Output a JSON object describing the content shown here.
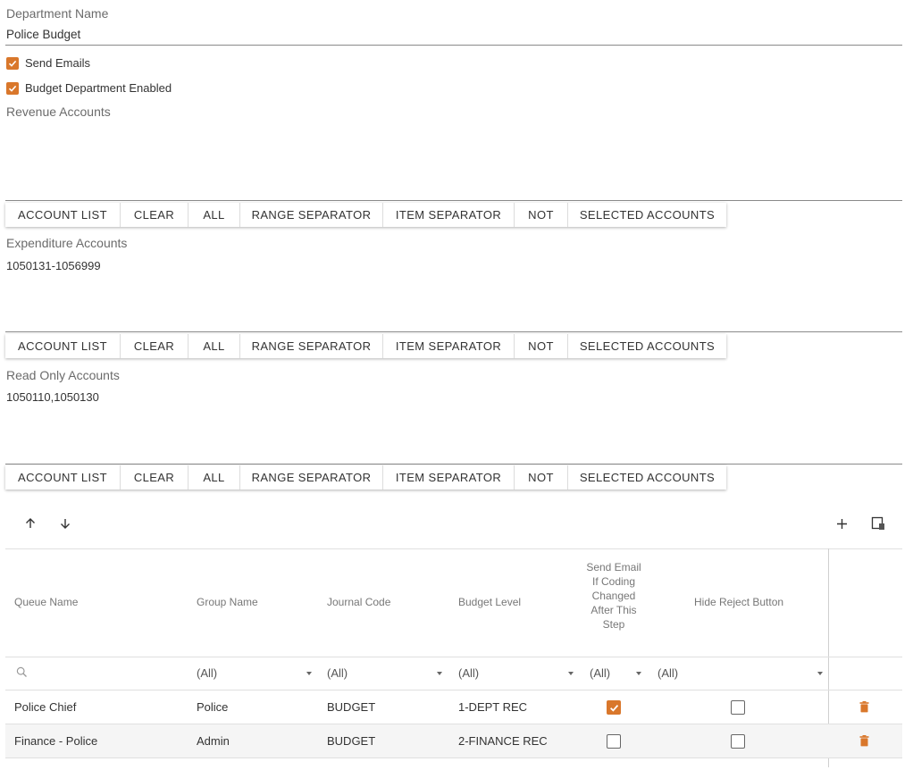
{
  "department": {
    "label": "Department Name",
    "value": "Police Budget"
  },
  "checkboxes": [
    {
      "label": "Send Emails",
      "checked": true
    },
    {
      "label": "Budget Department Enabled",
      "checked": true
    }
  ],
  "accent_color": "#d9772b",
  "sections": [
    {
      "label": "Revenue Accounts",
      "value": ""
    },
    {
      "label": "Expenditure Accounts",
      "value": "1050131-1056999"
    },
    {
      "label": "Read Only Accounts",
      "value": "1050110,1050130"
    }
  ],
  "toolbar_buttons": [
    "ACCOUNT LIST",
    "CLEAR",
    "ALL",
    "RANGE SEPARATOR",
    "ITEM SEPARATOR",
    "NOT",
    "SELECTED ACCOUNTS"
  ],
  "grid": {
    "toolbar_icons": [
      "arrow-up-icon",
      "arrow-down-icon",
      "plus-icon",
      "column-chooser-icon"
    ],
    "columns": [
      "Queue Name",
      "Group Name",
      "Journal Code",
      "Budget Level",
      "Send Email If Coding Changed After This Step",
      "Hide Reject Button"
    ],
    "filters": {
      "search_icon": "search-icon",
      "group": "(All)",
      "journal": "(All)",
      "level": "(All)",
      "email": "(All)",
      "reject": "(All)"
    },
    "rows": [
      {
        "queue": "Police Chief",
        "group": "Police",
        "journal": "BUDGET",
        "level": "1-DEPT REC",
        "send_email": true,
        "hide_reject": false,
        "action_icon": "trash-icon"
      },
      {
        "queue": "Finance - Police",
        "group": "Admin",
        "journal": "BUDGET",
        "level": "2-FINANCE REC",
        "send_email": false,
        "hide_reject": false,
        "action_icon": "trash-icon"
      }
    ]
  }
}
